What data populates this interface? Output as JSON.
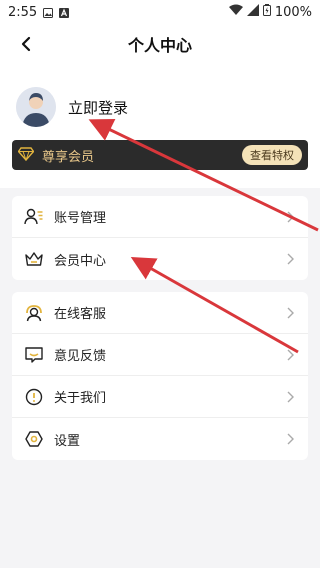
{
  "status_bar": {
    "time": "2:55",
    "battery": "100%"
  },
  "header": {
    "title": "个人中心"
  },
  "profile": {
    "login_text": "立即登录"
  },
  "vip": {
    "label": "尊享会员",
    "button": "查看特权"
  },
  "menu_group_1": [
    {
      "label": "账号管理",
      "icon": "account-manage-icon"
    },
    {
      "label": "会员中心",
      "icon": "crown-icon"
    }
  ],
  "menu_group_2": [
    {
      "label": "在线客服",
      "icon": "customer-service-icon"
    },
    {
      "label": "意见反馈",
      "icon": "feedback-icon"
    },
    {
      "label": "关于我们",
      "icon": "info-icon"
    },
    {
      "label": "设置",
      "icon": "settings-icon"
    }
  ],
  "colors": {
    "accent": "#e2b43e",
    "vip_bg": "#2b2b2b",
    "vip_text": "#e8c78a",
    "vip_button_bg": "#f4e2b8",
    "annotation_arrow": "#d9373b"
  }
}
